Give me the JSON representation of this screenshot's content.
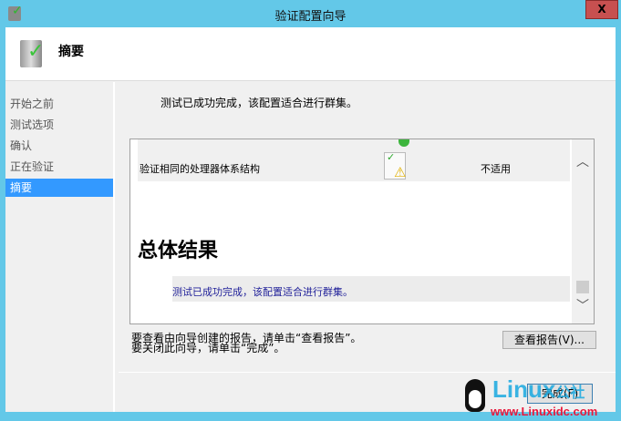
{
  "window": {
    "title": "验证配置向导",
    "close_label": "X"
  },
  "header": {
    "title": "摘要"
  },
  "nav": {
    "items": [
      {
        "label": "开始之前"
      },
      {
        "label": "测试选项"
      },
      {
        "label": "确认"
      },
      {
        "label": "正在验证"
      },
      {
        "label": "摘要",
        "selected": true
      }
    ]
  },
  "main": {
    "intro": "测试已成功完成，该配置适合进行群集。",
    "report": {
      "row_name": "验证相同的处理器体系结构",
      "row_result": "不适用",
      "overall_heading": "总体结果",
      "overall_text": "测试已成功完成，该配置适合进行群集。"
    },
    "hint_view": "要查看由向导创建的报告，请单击“查看报告”。",
    "hint_close": "要关闭此向导，请单击“完成”。",
    "view_report_label": "查看报告(V)...",
    "finish_label": "完成(F)"
  },
  "watermark": {
    "text": "Linux公社",
    "url": "www.Linuxidc.com"
  }
}
